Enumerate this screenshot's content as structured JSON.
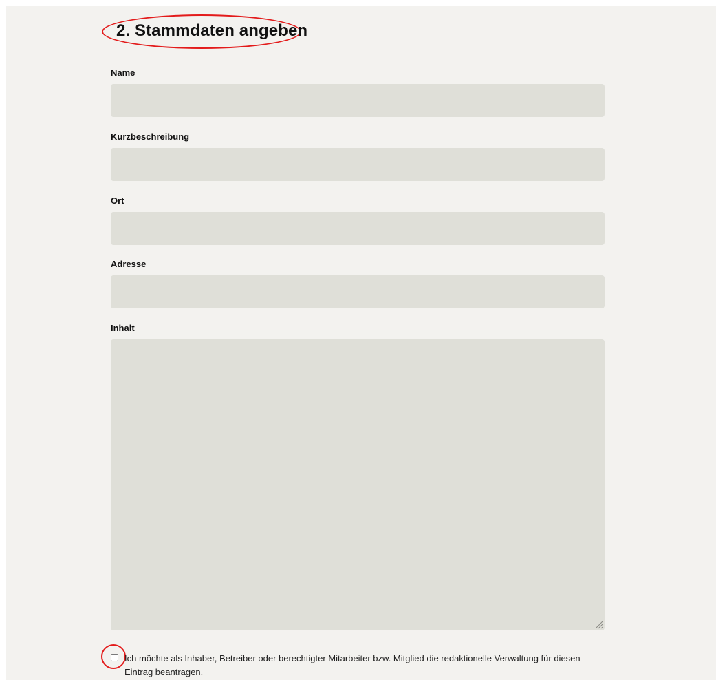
{
  "section": {
    "title": "2. Stammdaten angeben"
  },
  "fields": {
    "name": {
      "label": "Name",
      "value": ""
    },
    "kurzbeschreibung": {
      "label": "Kurzbeschreibung",
      "value": ""
    },
    "ort": {
      "label": "Ort",
      "value": ""
    },
    "adresse": {
      "label": "Adresse",
      "value": ""
    },
    "inhalt": {
      "label": "Inhalt",
      "value": ""
    }
  },
  "ownership_request": {
    "checked": false,
    "label": "Ich möchte als Inhaber, Betreiber oder berechtigter Mitarbeiter bzw. Mitglied die redaktionelle Verwaltung für diesen Eintrag beantragen."
  },
  "annotation": {
    "color": "#e31b1b"
  },
  "colors": {
    "page_background": "#f3f2ef",
    "input_background": "#dfdfd8",
    "text": "#111111"
  },
  "icons": {
    "textarea_resize": "resize-grip-icon"
  }
}
